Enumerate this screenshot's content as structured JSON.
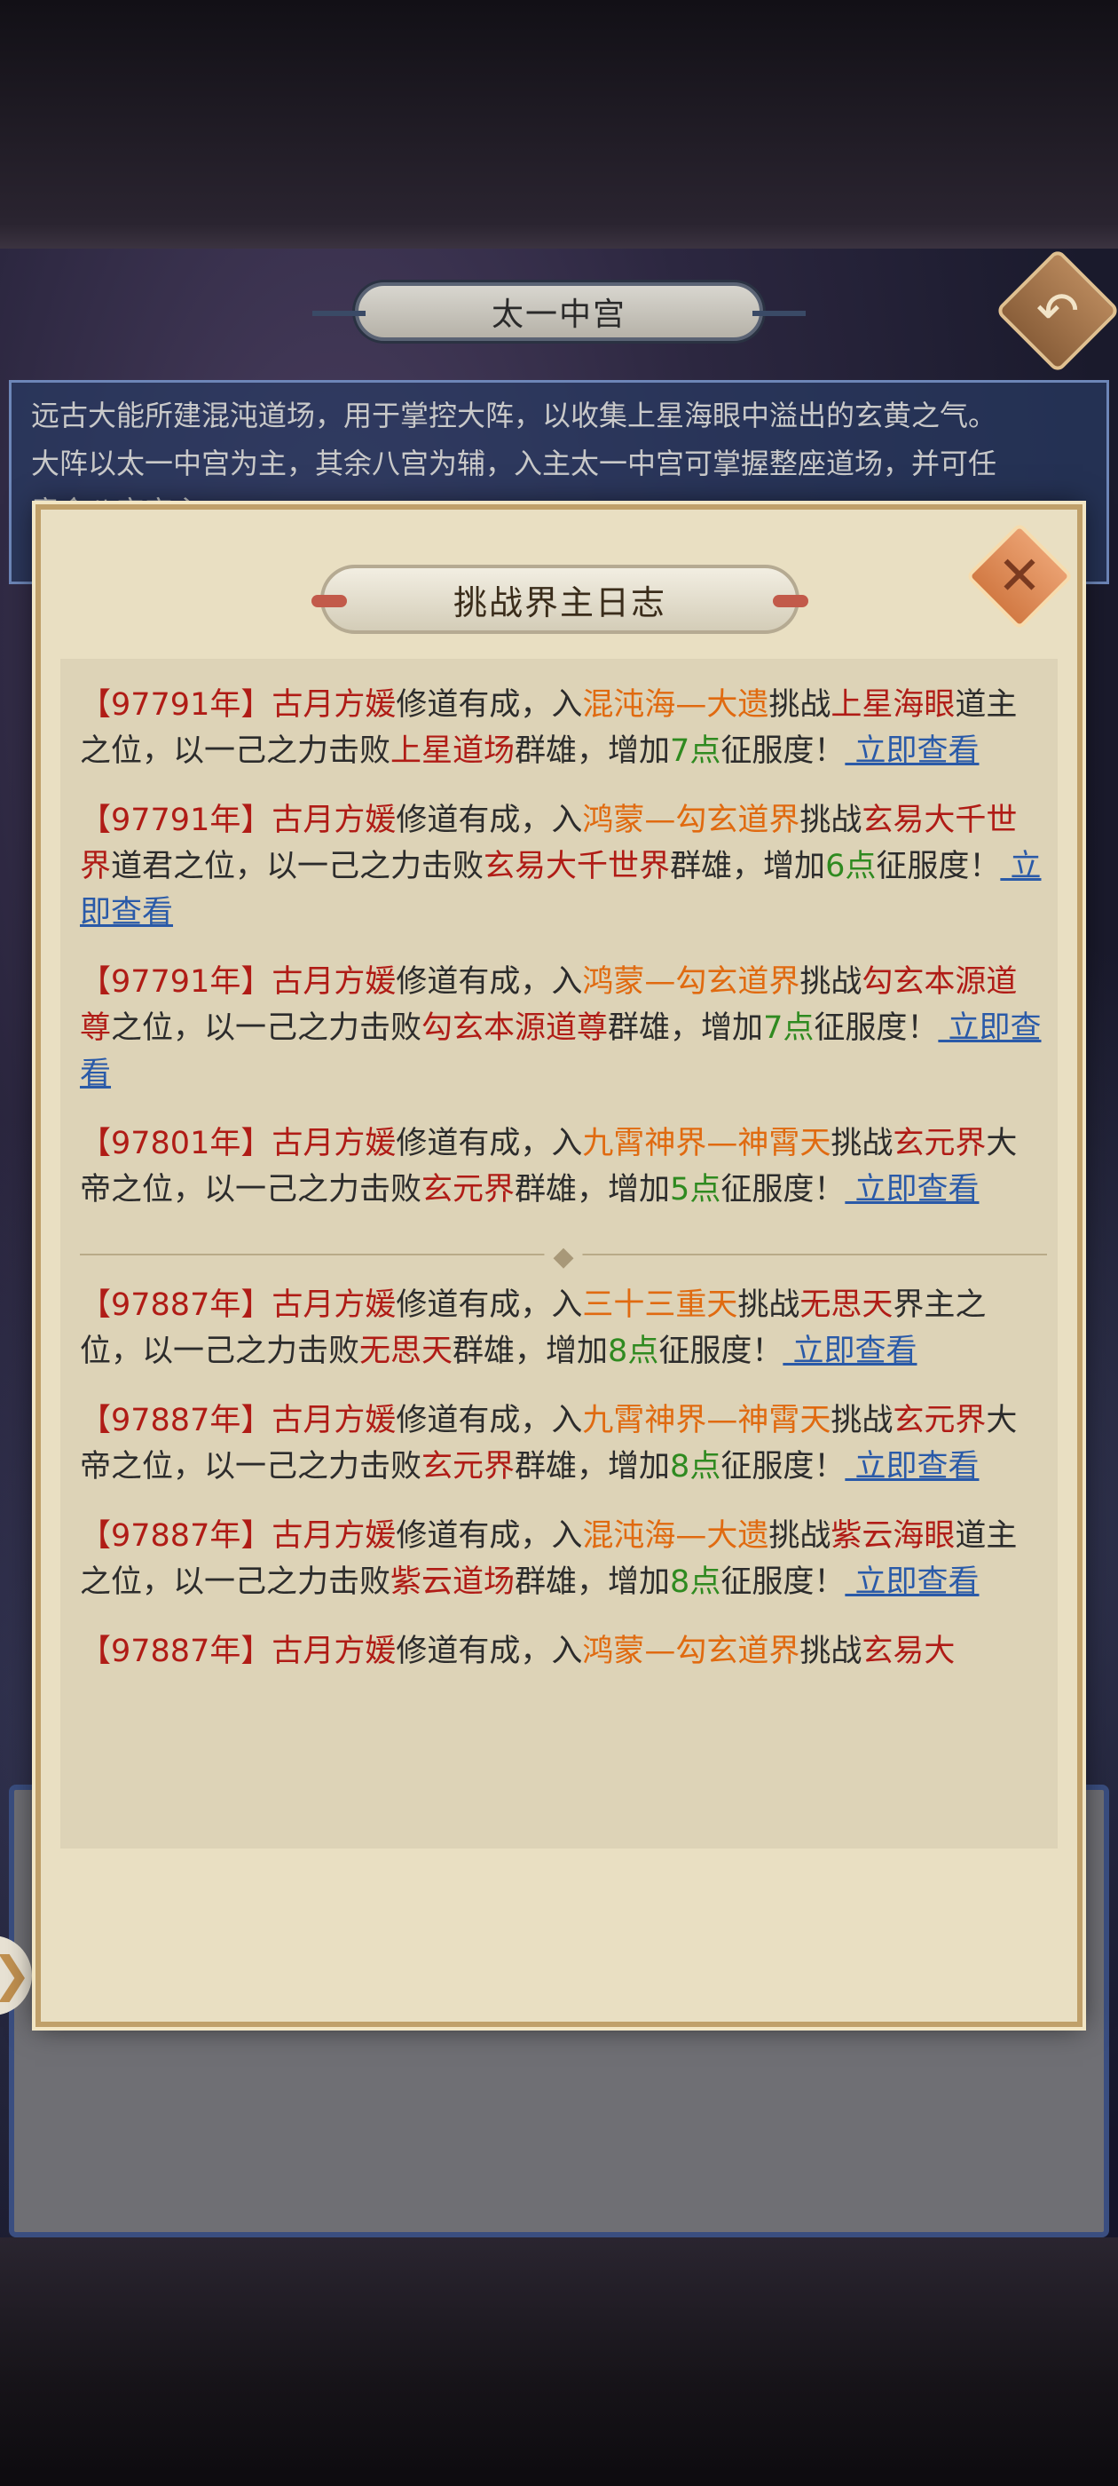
{
  "header": {
    "title": "太一中宫",
    "back_icon": "↶"
  },
  "description": {
    "line1": "远古大能所建混沌道场，用于掌控大阵，以收集上星海眼中溢出的玄黄之气。",
    "line2": "大阵以太一中宫为主，其余八宫为辅，入主太一中宫可掌握整座道场，并可任",
    "line3": "意命八宫宫主"
  },
  "modal": {
    "title": "挑战界主日志",
    "close_icon": "✕",
    "entries": [
      {
        "year": "【97791年】",
        "name": "古月方媛",
        "t1": "修道有成，入",
        "loc": "混沌海—大遗",
        "t2": "挑战",
        "target": "上星海眼",
        "t3": "道主之位，以一己之力击败",
        "defeated": "上星道场",
        "t4": "群雄，增加",
        "points": "7点",
        "t5": "征服度！",
        "link": "立即查看"
      },
      {
        "year": "【97791年】",
        "name": "古月方媛",
        "t1": "修道有成，入",
        "loc": "鸿蒙—勾玄道界",
        "t2": "挑战",
        "target": "玄易大千世界",
        "t3": "道君之位，以一己之力击败",
        "defeated": "玄易大千世界",
        "t4": "群雄，增加",
        "points": "6点",
        "t5": "征服度！",
        "link": "立即查看"
      },
      {
        "year": "【97791年】",
        "name": "古月方媛",
        "t1": "修道有成，入",
        "loc": "鸿蒙—勾玄道界",
        "t2": "挑战",
        "target": "勾玄本源道尊",
        "t3": "之位，以一己之力击败",
        "defeated": "勾玄本源道尊",
        "t4": "群雄，增加",
        "points": "7点",
        "t5": "征服度！",
        "link": "立即查看"
      },
      {
        "year": "【97801年】",
        "name": "古月方媛",
        "t1": "修道有成，入",
        "loc": "九霄神界—神霄天",
        "t2": "挑战",
        "target": "玄元界",
        "t3": "大帝之位，以一己之力击败",
        "defeated": "玄元界",
        "t4": "群雄，增加",
        "points": "5点",
        "t5": "征服度！",
        "link": "立即查看"
      },
      {
        "year": "【97887年】",
        "name": "古月方媛",
        "t1": "修道有成，入",
        "loc": "三十三重天",
        "t2": "挑战",
        "target": "无思天",
        "t3": "界主之位，以一己之力击败",
        "defeated": "无思天",
        "t4": "群雄，增加",
        "points": "8点",
        "t5": "征服度！",
        "link": "立即查看"
      },
      {
        "year": "【97887年】",
        "name": "古月方媛",
        "t1": "修道有成，入",
        "loc": "九霄神界—神霄天",
        "t2": "挑战",
        "target": "玄元界",
        "t3": "大帝之位，以一己之力击败",
        "defeated": "玄元界",
        "t4": "群雄，增加",
        "points": "8点",
        "t5": "征服度！",
        "link": "立即查看"
      },
      {
        "year": "【97887年】",
        "name": "古月方媛",
        "t1": "修道有成，入",
        "loc": "混沌海—大遗",
        "t2": "挑战",
        "target": "紫云海眼",
        "t3": "道主之位，以一己之力击败",
        "defeated": "紫云道场",
        "t4": "群雄，增加",
        "points": "8点",
        "t5": "征服度！",
        "link": "立即查看"
      },
      {
        "year": "【97887年】",
        "name": "古月方媛",
        "t1": "修道有成，入",
        "loc": "鸿蒙—勾玄道界",
        "t2": "挑战",
        "target": "玄易大",
        "t3": "",
        "defeated": "",
        "t4": "",
        "points": "",
        "t5": "",
        "link": ""
      }
    ]
  },
  "side_tab": {
    "icon": "❯"
  }
}
